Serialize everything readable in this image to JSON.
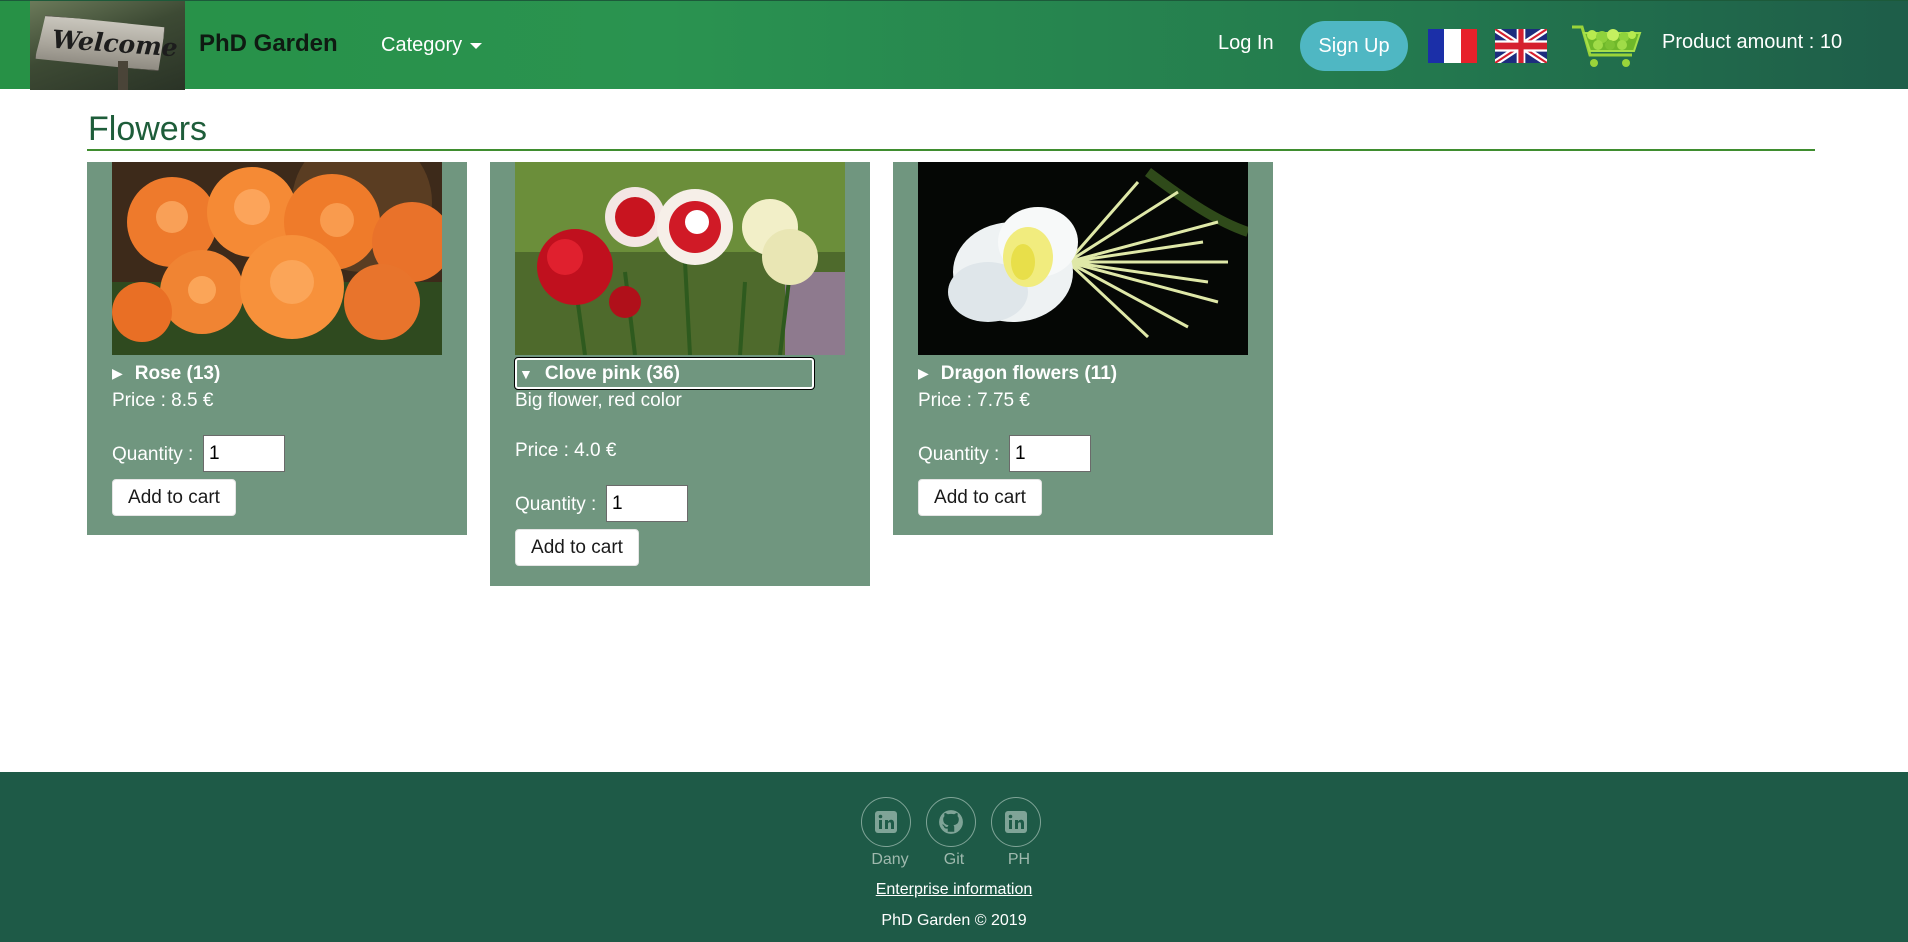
{
  "header": {
    "brand": "PhD Garden",
    "logo_text": "Welcome",
    "category_label": "Category",
    "login_label": "Log In",
    "signup_label": "Sign Up",
    "product_amount": "Product amount : 10"
  },
  "page": {
    "title": "Flowers"
  },
  "products": [
    {
      "name": "Rose (13)",
      "expanded": false,
      "description": "",
      "price": "Price : 8.5 €",
      "quantity_label": "Quantity :",
      "quantity_value": "1",
      "add_label": "Add to cart"
    },
    {
      "name": "Clove pink (36)",
      "expanded": true,
      "description": "Big flower, red color",
      "price": "Price : 4.0 €",
      "quantity_label": "Quantity :",
      "quantity_value": "1",
      "add_label": "Add to cart"
    },
    {
      "name": "Dragon flowers (11)",
      "expanded": false,
      "description": "",
      "price": "Price : 7.75 €",
      "quantity_label": "Quantity :",
      "quantity_value": "1",
      "add_label": "Add to cart"
    }
  ],
  "footer": {
    "social": [
      {
        "label": "Dany",
        "icon": "linkedin-icon"
      },
      {
        "label": "Git",
        "icon": "github-icon"
      },
      {
        "label": "PH",
        "icon": "linkedin-icon"
      }
    ],
    "enterprise_link": "Enterprise information",
    "copyright": "PhD Garden © 2019"
  },
  "colors": {
    "navbar_start": "#279146",
    "navbar_end": "#1e5d49",
    "signup_bg": "#4fb7c3",
    "card_bg": "#70967f",
    "footer_bg": "#1e5a47",
    "title_color": "#1e5d3a"
  }
}
